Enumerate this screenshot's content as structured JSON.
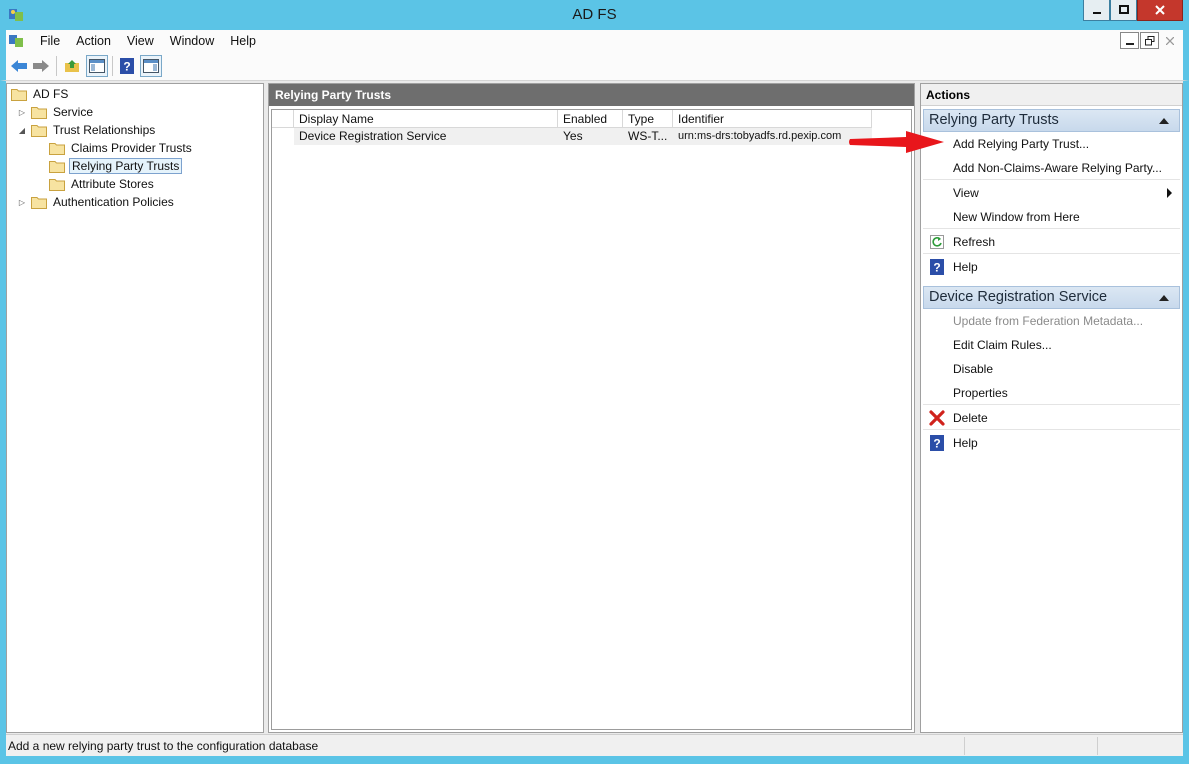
{
  "window": {
    "title": "AD FS",
    "icon": "adfs-app-icon",
    "controls": [
      "minimize",
      "maximize",
      "close"
    ]
  },
  "menu": {
    "items": [
      "File",
      "Action",
      "View",
      "Window",
      "Help"
    ]
  },
  "toolbar": {
    "buttons": [
      "back-arrow-icon",
      "forward-arrow-icon",
      "up-folder-icon",
      "show-hide-tree-icon",
      "help-icon",
      "show-hide-action-pane-icon"
    ]
  },
  "tree": {
    "root": "AD FS",
    "items": [
      {
        "label": "Service",
        "expander": "collapsed"
      },
      {
        "label": "Trust Relationships",
        "expander": "expanded"
      },
      {
        "label": "Claims Provider Trusts"
      },
      {
        "label": "Relying Party Trusts",
        "selected": true
      },
      {
        "label": "Attribute Stores"
      },
      {
        "label": "Authentication Policies",
        "expander": "collapsed"
      }
    ]
  },
  "middle": {
    "header": "Relying Party Trusts",
    "columns": [
      "Display Name",
      "Enabled",
      "Type",
      "Identifier"
    ],
    "rows": [
      {
        "display_name": "Device Registration Service",
        "enabled": "Yes",
        "type": "WS-T...",
        "identifier": "urn:ms-drs:tobyadfs.rd.pexip.com"
      }
    ]
  },
  "actions": {
    "title": "Actions",
    "sections": [
      {
        "header": "Relying Party Trusts",
        "items": [
          {
            "label": "Add Relying Party Trust..."
          },
          {
            "label": "Add Non-Claims-Aware Relying Party..."
          },
          {
            "label": "View",
            "submenu": true
          },
          {
            "label": "New Window from Here"
          },
          {
            "label": "Refresh",
            "icon": "refresh-icon"
          },
          {
            "label": "Help",
            "icon": "help-icon"
          }
        ]
      },
      {
        "header": "Device Registration Service",
        "items": [
          {
            "label": "Update from Federation Metadata...",
            "disabled": true
          },
          {
            "label": "Edit Claim Rules..."
          },
          {
            "label": "Disable"
          },
          {
            "label": "Properties"
          },
          {
            "label": "Delete",
            "icon": "delete-icon"
          },
          {
            "label": "Help",
            "icon": "help-icon"
          }
        ]
      }
    ]
  },
  "status": {
    "text": "Add a new relying party trust to the configuration database"
  },
  "colors": {
    "window_frame": "#5bc4e6",
    "pane_header": "#6e6e6e",
    "action_section_header": "#c8d9ec",
    "annotation_arrow": "#e8161b"
  }
}
